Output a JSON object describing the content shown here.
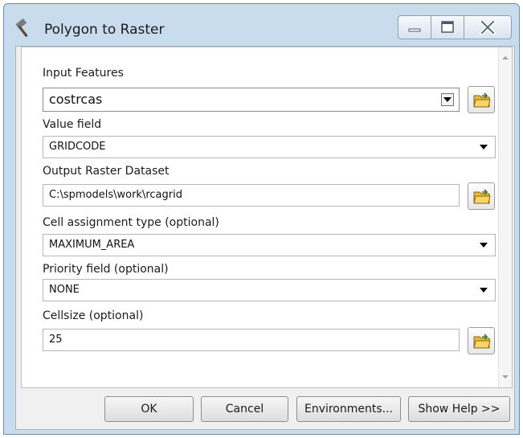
{
  "window": {
    "title": "Polygon to Raster",
    "icon": "hammer-icon",
    "controls": [
      "minimize-icon",
      "maximize-icon",
      "close-icon"
    ]
  },
  "form": {
    "input_features": {
      "label": "Input Features",
      "value": "costrcas"
    },
    "value_field": {
      "label": "Value field",
      "value": "GRIDCODE"
    },
    "output_raster": {
      "label": "Output Raster Dataset",
      "value": "C:\\spmodels\\work\\rcagrid"
    },
    "cell_assignment": {
      "label": "Cell assignment type (optional)",
      "value": "MAXIMUM_AREA"
    },
    "priority_field": {
      "label": "Priority field (optional)",
      "value": "NONE"
    },
    "cellsize": {
      "label": "Cellsize (optional)",
      "value": "25"
    }
  },
  "buttons": {
    "ok": "OK",
    "cancel": "Cancel",
    "environments": "Environments...",
    "show_help": "Show Help >>"
  },
  "colors": {
    "frame": "#c9dced",
    "client": "#f0f0f0",
    "folder": "#e8b93a"
  }
}
